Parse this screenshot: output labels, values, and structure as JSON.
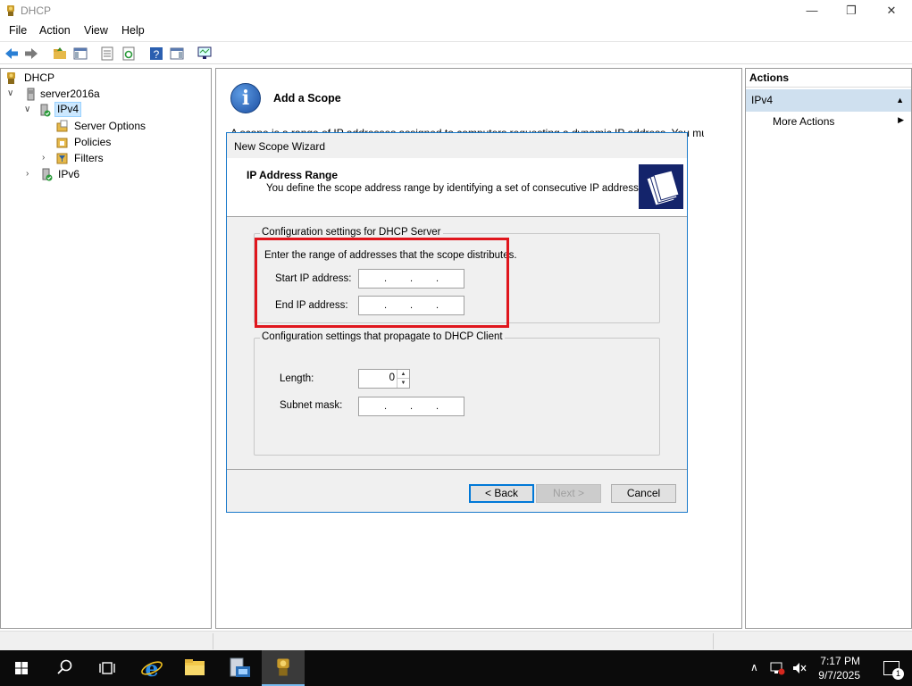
{
  "window": {
    "title": "DHCP",
    "minimize": "—",
    "restore": "❐",
    "close": "✕"
  },
  "menu": [
    "File",
    "Action",
    "View",
    "Help"
  ],
  "tree": {
    "root": "DHCP",
    "server": "server2016a",
    "ipv4": "IPv4",
    "server_options": "Server Options",
    "policies": "Policies",
    "filters": "Filters",
    "ipv6": "IPv6"
  },
  "scope_panel": {
    "title": "Add a Scope",
    "description": "A scope is a range of IP addresses assigned to computers requesting a dynamic IP address. You must"
  },
  "wizard": {
    "window_title": "New Scope Wizard",
    "heading": "IP Address Range",
    "subheading": "You define the scope address range by identifying a set of consecutive IP addresses.",
    "group1_legend": "Configuration settings for DHCP Server",
    "instruction": "Enter the range of addresses that the scope distributes.",
    "start_ip_label": "Start IP address:",
    "end_ip_label": "End IP address:",
    "group2_legend": "Configuration settings that propagate to DHCP Client",
    "length_label": "Length:",
    "length_value": "0",
    "subnet_label": "Subnet mask:",
    "back_button": "< Back",
    "next_button": "Next >",
    "cancel_button": "Cancel"
  },
  "actions": {
    "header": "Actions",
    "section": "IPv4",
    "more_actions": "More Actions"
  },
  "taskbar": {
    "time": "7:17 PM",
    "date": "9/7/2025",
    "notification_count": "1"
  },
  "colors": {
    "accent": "#0078d7",
    "highlight_box": "#e0161d",
    "selection": "#cce8ff",
    "wizard_border": "#1979ca"
  }
}
